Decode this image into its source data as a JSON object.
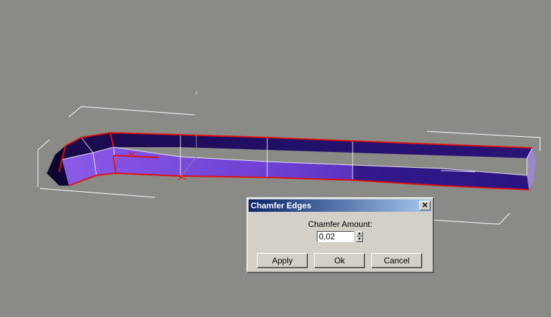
{
  "viewport": {
    "axis_label": "z"
  },
  "dialog": {
    "title": "Chamfer Edges",
    "close_glyph": "✕",
    "amount_label": "Chamfer Amount:",
    "amount_value": "0,02",
    "spin_up_glyph": "▲",
    "spin_down_glyph": "▼",
    "apply_label": "Apply",
    "ok_label": "Ok",
    "cancel_label": "Cancel"
  },
  "colors": {
    "viewport_bg": "#8a8b87",
    "mesh_dark": "#1a0a4a",
    "mesh_mid": "#3a1a8a",
    "mesh_light": "#7a4fd6",
    "selected_edge": "#e01010",
    "bbox": "#ffffff",
    "titlebar": "#0a246a"
  }
}
